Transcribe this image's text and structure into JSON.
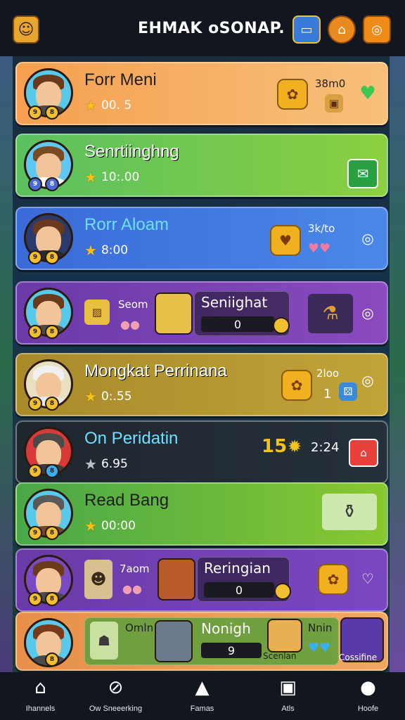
{
  "header": {
    "title": "EHMAK oSONAP.",
    "logo_icon": "hero-portrait-icon",
    "buttons": [
      "card-icon",
      "arrow-up-icon",
      "shop-bag-icon"
    ]
  },
  "cards": [
    {
      "name": "Forr Meni",
      "score": "00. 5",
      "right_value": "38m0",
      "status_icon": "check-heart-icon",
      "colors": [
        "#f5a85a",
        "#f7c88a"
      ]
    },
    {
      "name": "Senrtiinghng",
      "score": "10:.00"
    },
    {
      "name": "Rorr Aloam",
      "score": "8:00",
      "right_value": "3k/to"
    },
    {
      "label_left": "Seom",
      "panel_title": "Seniighat",
      "panel_value": "0"
    },
    {
      "name": "Mongkat Perrinana",
      "score": "0:.55",
      "right_value": "2loo",
      "right_num": "1"
    },
    {
      "name": "On Peridatin",
      "score": "6.95",
      "right_big": "15",
      "right_value": "2:24"
    },
    {
      "name": "Read Bang",
      "score": "00:00"
    },
    {
      "label_left": "7aom",
      "panel_title": "Reringian",
      "panel_value": "0"
    },
    {
      "panel_title": "Nonigh",
      "panel_value": "9",
      "label_left": "Omln",
      "label_right": "Nnin",
      "mini_caption_1": "Scenlan",
      "mini_caption_2": "Cossifine"
    }
  ],
  "tabs": [
    {
      "label": "Ihannels",
      "icon": "home-icon"
    },
    {
      "label": "Ow Sneeerking",
      "icon": "search-icon"
    },
    {
      "label": "Famas",
      "icon": "lock-icon"
    },
    {
      "label": "Atls",
      "icon": "frame-icon"
    },
    {
      "label": "Hoofe",
      "icon": "profile-icon"
    }
  ]
}
